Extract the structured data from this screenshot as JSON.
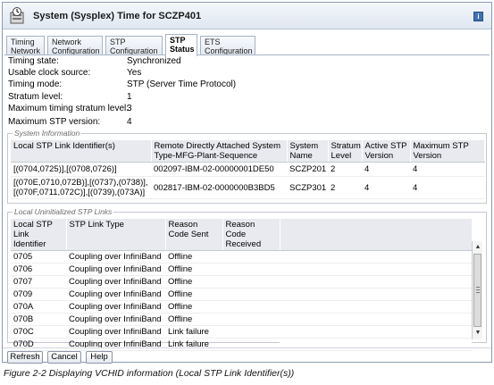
{
  "window": {
    "title": "System (Sysplex) Time for SCZP401"
  },
  "tabs": [
    {
      "label": "Timing Network"
    },
    {
      "label": "Network Configuration"
    },
    {
      "label": "STP Configuration"
    },
    {
      "label": "STP Status"
    },
    {
      "label": "ETS Configuration"
    }
  ],
  "properties": [
    {
      "label": "Timing state:",
      "value": "Synchronized"
    },
    {
      "label": "Usable clock source:",
      "value": "Yes"
    },
    {
      "label": "Timing mode:",
      "value": "STP (Server Time Protocol)"
    },
    {
      "label": "Stratum level:",
      "value": "1"
    },
    {
      "label": "Maximum timing stratum level:",
      "value": "3"
    },
    {
      "label": "Maximum STP version:",
      "value": "4"
    }
  ],
  "system_info": {
    "legend": "System Information",
    "headers": [
      "Local STP Link Identifier(s)",
      "Remote Directly Attached System Type-MFG-Plant-Sequence",
      "System Name",
      "Stratum Level",
      "Active STP Version",
      "Maximum STP Version"
    ],
    "rows": [
      [
        "[(0704,0725)],[(0708,0726)]",
        "002097-IBM-02-00000001DE50",
        "SCZP201",
        "2",
        "4",
        "4"
      ],
      [
        "[(070E,0710,072B)],[(0737),(0738)],[(070F,0711,072C)],[(0739),(073A)]",
        "002817-IBM-02-0000000B3BD5",
        "SCZP301",
        "2",
        "4",
        "4"
      ]
    ]
  },
  "uninit_links": {
    "legend": "Local Uninitialized STP Links",
    "headers": [
      "Local STP Link Identifier",
      "STP Link Type",
      "Reason Code Sent",
      "Reason Code Received"
    ],
    "rows": [
      [
        "0705",
        "Coupling over InfiniBand",
        "Offline",
        ""
      ],
      [
        "0706",
        "Coupling over InfiniBand",
        "Offline",
        ""
      ],
      [
        "0707",
        "Coupling over InfiniBand",
        "Offline",
        ""
      ],
      [
        "0709",
        "Coupling over InfiniBand",
        "Offline",
        ""
      ],
      [
        "070A",
        "Coupling over InfiniBand",
        "Offline",
        ""
      ],
      [
        "070B",
        "Coupling over InfiniBand",
        "Offline",
        ""
      ],
      [
        "070C",
        "Coupling over InfiniBand",
        "Link failure",
        ""
      ],
      [
        "070D",
        "Coupling over InfiniBand",
        "Link failure",
        ""
      ]
    ]
  },
  "buttons": {
    "refresh": "Refresh",
    "cancel": "Cancel",
    "help": "Help"
  },
  "help_glyph": "i",
  "caption": "Figure 2-2   Displaying VCHID information (Local STP Link Identifier(s))",
  "icons": {
    "app": "server-clock-icon",
    "help": "help-icon"
  }
}
